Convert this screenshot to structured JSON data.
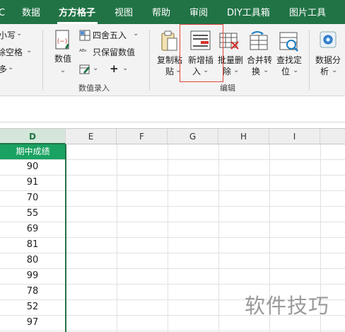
{
  "menu_tabs": [
    {
      "label": "C"
    },
    {
      "label": "数据"
    },
    {
      "label": "方方格子",
      "active": true
    },
    {
      "label": "视图"
    },
    {
      "label": "帮助"
    },
    {
      "label": "审阅"
    },
    {
      "label": "DIY工具箱"
    },
    {
      "label": "图片工具"
    }
  ],
  "ribbon": {
    "left_group": {
      "items": [
        "小写",
        "除空格",
        "多"
      ]
    },
    "value_entry_group": {
      "value_button": "数值",
      "round_label": "四舍五入",
      "keep_value_label": "只保留数值",
      "plus_label": "+",
      "group_label": "数值录入"
    },
    "edit_group": {
      "buttons": [
        {
          "line1": "复制粘",
          "line2": "贴"
        },
        {
          "line1": "新增插",
          "line2": "入"
        },
        {
          "line1": "批量删",
          "line2": "除"
        },
        {
          "line1": "合并转",
          "line2": "换"
        },
        {
          "line1": "查找定",
          "line2": "位"
        }
      ],
      "group_label": "编辑"
    },
    "data_analysis": {
      "line1": "数据分",
      "line2": "析"
    }
  },
  "grid": {
    "columns": [
      "D",
      "E",
      "F",
      "G",
      "H",
      "I"
    ],
    "selected_column": "D",
    "header_cell": "期中成绩",
    "scores": [
      "90",
      "91",
      "70",
      "55",
      "69",
      "81",
      "80",
      "99",
      "78",
      "52",
      "97"
    ]
  },
  "watermark": "软件技巧",
  "colors": {
    "menu_bg": "#217346",
    "header_fill": "#1aa262",
    "highlight": "#e0463c"
  }
}
